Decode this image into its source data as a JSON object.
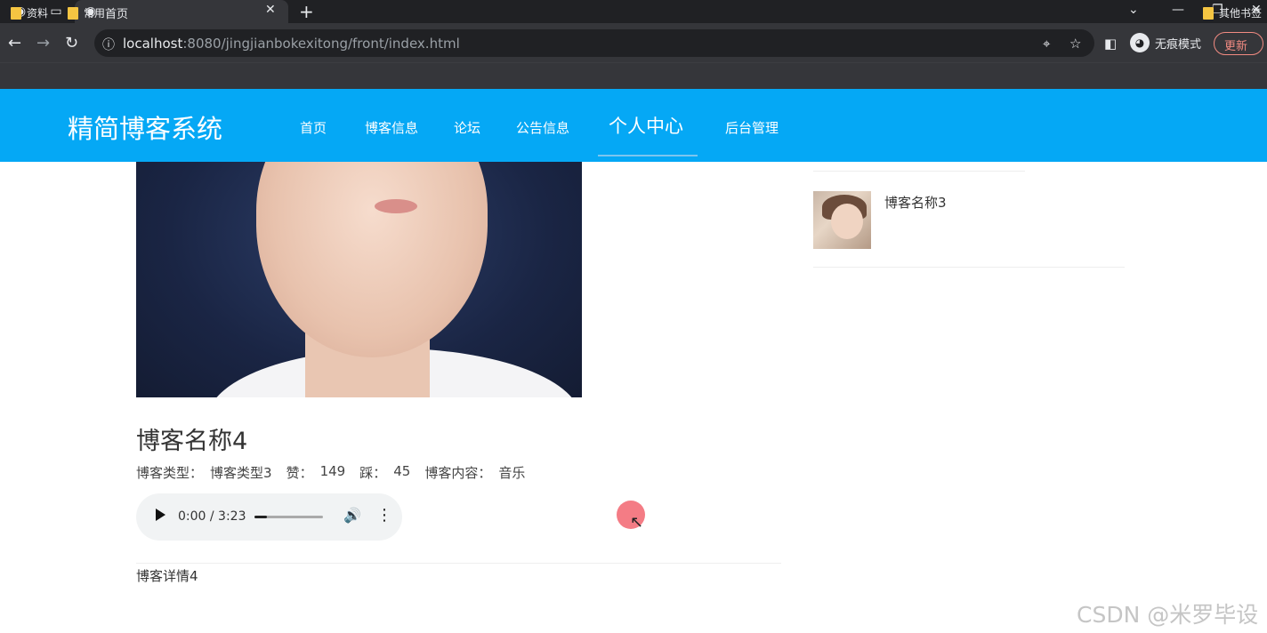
{
  "browser": {
    "tab_title": "首页",
    "url_host": "localhost",
    "url_rest": ":8080/jingjianbokexitong/front/index.html",
    "incognito_label": "无痕模式",
    "update_label": "更新",
    "bookmarks": [
      "资料",
      "常用"
    ],
    "other_bookmarks": "其他书签"
  },
  "site": {
    "logo": "精简博客系统",
    "nav": [
      "首页",
      "博客信息",
      "论坛",
      "公告信息",
      "个人中心",
      "后台管理"
    ]
  },
  "blog": {
    "title": "博客名称4",
    "type_label": "博客类型：",
    "type_value": "博客类型3",
    "like_label": "赞：",
    "like_value": "149",
    "dislike_label": "踩：",
    "dislike_value": "45",
    "content_label": "博客内容：",
    "content_value": "音乐",
    "audio_time": "0:00 / 3:23",
    "audio_progress": 0.18,
    "detail": "博客详情4"
  },
  "sidebar": {
    "items": [
      {
        "name": "博客名称3"
      }
    ]
  },
  "watermark": "CSDN @米罗毕设",
  "colors": {
    "header": "#05a8f5",
    "chrome": "#35363a"
  }
}
